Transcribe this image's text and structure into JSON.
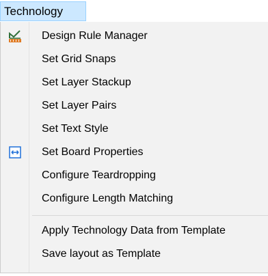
{
  "menubar": {
    "title": "Technology"
  },
  "menu": {
    "items": [
      {
        "label": "Design Rule Manager",
        "icon": "design-rule-manager-icon"
      },
      {
        "label": "Set Grid Snaps"
      },
      {
        "label": "Set Layer Stackup"
      },
      {
        "label": "Set Layer Pairs"
      },
      {
        "label": "Set Text Style"
      },
      {
        "label": "Set Board Properties",
        "icon": "board-properties-icon"
      },
      {
        "label": "Configure Teardropping"
      },
      {
        "label": "Configure Length Matching"
      },
      {
        "label": "Apply Technology Data from Template"
      },
      {
        "label": "Save layout as Template"
      }
    ]
  },
  "colors": {
    "menubar_highlight": "#cce8ff",
    "menubar_highlight_border": "#99d1ff",
    "menu_background": "#f2f2f2",
    "icon_blue": "#1e6fd9",
    "icon_orange": "#e07b24"
  }
}
